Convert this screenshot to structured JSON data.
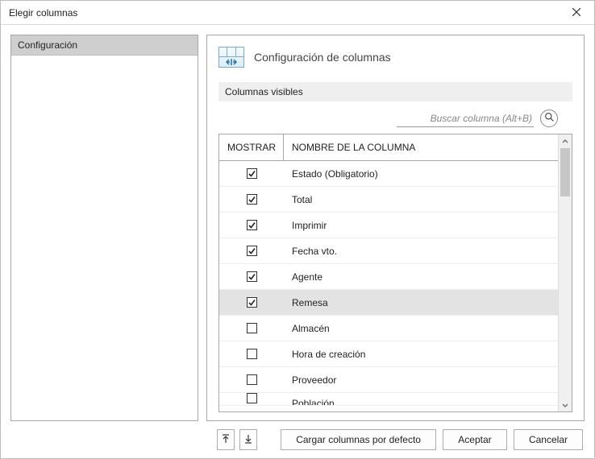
{
  "window": {
    "title": "Elegir columnas"
  },
  "sidebar": {
    "items": [
      {
        "label": "Configuración"
      }
    ]
  },
  "header": {
    "title": "Configuración de columnas"
  },
  "section": {
    "visible_columns_label": "Columnas visibles"
  },
  "search": {
    "placeholder": "Buscar columna (Alt+B)"
  },
  "table": {
    "headers": {
      "show": "MOSTRAR",
      "name": "NOMBRE DE LA COLUMNA"
    },
    "rows": [
      {
        "checked": true,
        "name": "Estado (Obligatorio)",
        "selected": false
      },
      {
        "checked": true,
        "name": "Total",
        "selected": false
      },
      {
        "checked": true,
        "name": "Imprimir",
        "selected": false
      },
      {
        "checked": true,
        "name": "Fecha vto.",
        "selected": false
      },
      {
        "checked": true,
        "name": "Agente",
        "selected": false
      },
      {
        "checked": true,
        "name": "Remesa",
        "selected": true
      },
      {
        "checked": false,
        "name": "Almacén",
        "selected": false
      },
      {
        "checked": false,
        "name": "Hora de creación",
        "selected": false
      },
      {
        "checked": false,
        "name": "Proveedor",
        "selected": false
      },
      {
        "checked": false,
        "name": "Población",
        "selected": false
      }
    ]
  },
  "footer": {
    "load_defaults_label": "Cargar columnas por defecto",
    "accept_label": "Aceptar",
    "cancel_label": "Cancelar"
  }
}
